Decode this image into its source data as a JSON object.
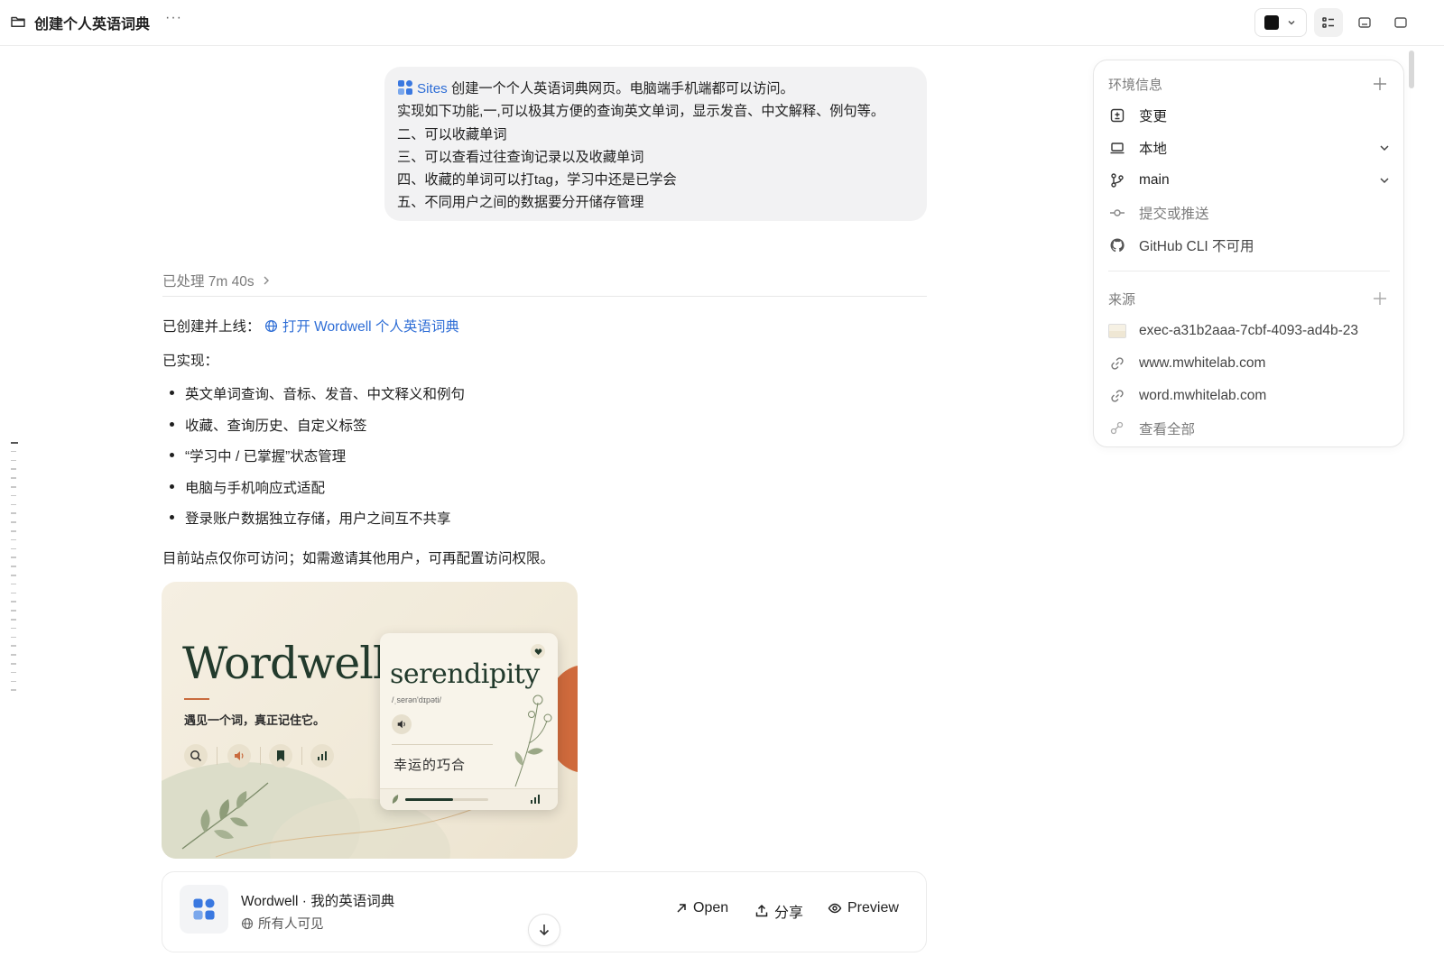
{
  "header": {
    "title": "创建个人英语词典",
    "more": "···"
  },
  "user_message": {
    "sites_tag": "Sites",
    "lines": [
      "创建一个个人英语词典网页。电脑端手机端都可以访问。",
      "实现如下功能,一,可以极其方便的查询英文单词，显示发音、中文解释、例句等。",
      "二、可以收藏单词",
      "三、可以查看过往查询记录以及收藏单词",
      "四、收藏的单词可以打tag，学习中还是已学会",
      "五、不同用户之间的数据要分开储存管理"
    ]
  },
  "assistant": {
    "processed": "已处理 7m 40s",
    "created_label": "已创建并上线：",
    "open_link": "打开 Wordwell 个人英语词典",
    "implemented_label": "已实现：",
    "bullets": [
      "英文单词查询、音标、发音、中文释义和例句",
      "收藏、查询历史、自定义标签",
      "“学习中 / 已掌握”状态管理",
      "电脑与手机响应式适配",
      "登录账户数据独立存储，用户之间互不共享"
    ],
    "note": "目前站点仅你可访问；如需邀请其他用户，可再配置访问权限。"
  },
  "preview": {
    "brand": "Wordwell",
    "tagline": "遇见一个词，真正记住它。",
    "word": "serendipity",
    "ipa": "/ˌserən'dɪpəti/",
    "translation": "幸运的巧合",
    "progress": 0.58,
    "colors": {
      "accent": "#c96b3e",
      "ink": "#223a2c",
      "paper": "#f5efe2"
    }
  },
  "site_card": {
    "name": "Wordwell · 我的英语词典",
    "visibility": "所有人可见",
    "actions": {
      "open": "Open",
      "share": "分享",
      "preview": "Preview"
    }
  },
  "panel": {
    "env_title": "环境信息",
    "env_items": [
      {
        "label": "变更",
        "icon": "diff-icon"
      },
      {
        "label": "本地",
        "icon": "laptop-icon"
      },
      {
        "label": "main",
        "icon": "branch-icon"
      },
      {
        "label": "提交或推送",
        "icon": "commit-icon"
      },
      {
        "label": "GitHub CLI 不可用",
        "icon": "github-icon"
      }
    ],
    "source_title": "来源",
    "source_items": [
      {
        "label": "exec-a31b2aaa-7cbf-4093-ad4b-23",
        "icon": "thumbnail-icon"
      },
      {
        "label": "www.mwhitelab.com",
        "icon": "link-icon"
      },
      {
        "label": "word.mwhitelab.com",
        "icon": "link-icon"
      },
      {
        "label": "查看全部",
        "icon": "links-icon"
      }
    ]
  }
}
